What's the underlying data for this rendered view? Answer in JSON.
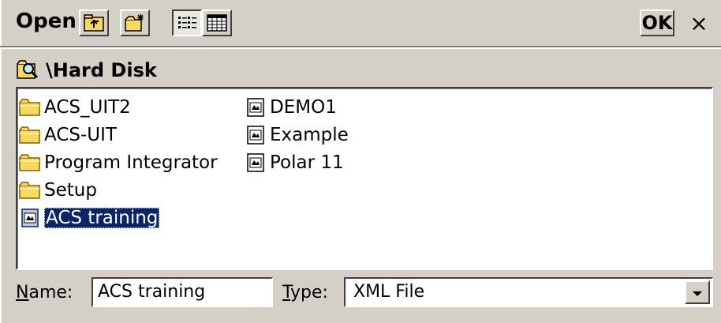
{
  "titlebar": {
    "title": "Open",
    "ok_label": "OK",
    "close_label": "×"
  },
  "path": {
    "text": "\\Hard Disk"
  },
  "files": {
    "column1": [
      {
        "label": "ACS_UIT2",
        "icon": "folder-icon"
      },
      {
        "label": "ACS-UIT",
        "icon": "folder-icon"
      },
      {
        "label": "Program Integrator",
        "icon": "folder-icon"
      },
      {
        "label": "Setup",
        "icon": "folder-icon"
      },
      {
        "label": "ACS training",
        "icon": "xml-file-icon",
        "selected": true
      }
    ],
    "column2": [
      {
        "label": "DEMO1",
        "icon": "xml-file-icon"
      },
      {
        "label": "Example",
        "icon": "xml-file-icon"
      },
      {
        "label": "Polar 11",
        "icon": "xml-file-icon"
      }
    ]
  },
  "footer": {
    "name_label_first": "N",
    "name_label_rest": "ame:",
    "name_value": "ACS training",
    "type_label_first": "T",
    "type_label_rest": "ype:",
    "type_value": "XML File"
  },
  "colors": {
    "face": "#d4d0c8",
    "selection": "#0a246a",
    "folder": "#f8d860"
  }
}
